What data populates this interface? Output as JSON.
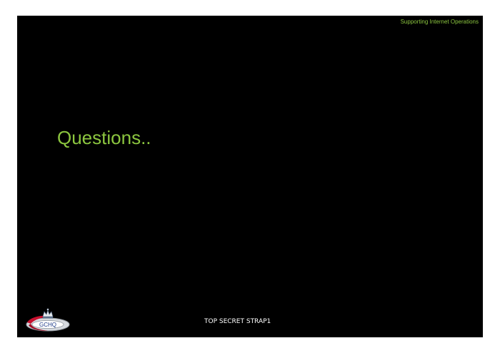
{
  "header": {
    "label": "Supporting Internet Operations"
  },
  "slide": {
    "title": "Questions.."
  },
  "footer": {
    "classification": "TOP SECRET STRAP1",
    "logo_text": "GCHQ"
  },
  "colors": {
    "background": "#000000",
    "accent_green": "#8cc63f",
    "footer_text": "#ffffff",
    "logo_red": "#c8102e",
    "logo_silver": "#b9bfc6"
  }
}
